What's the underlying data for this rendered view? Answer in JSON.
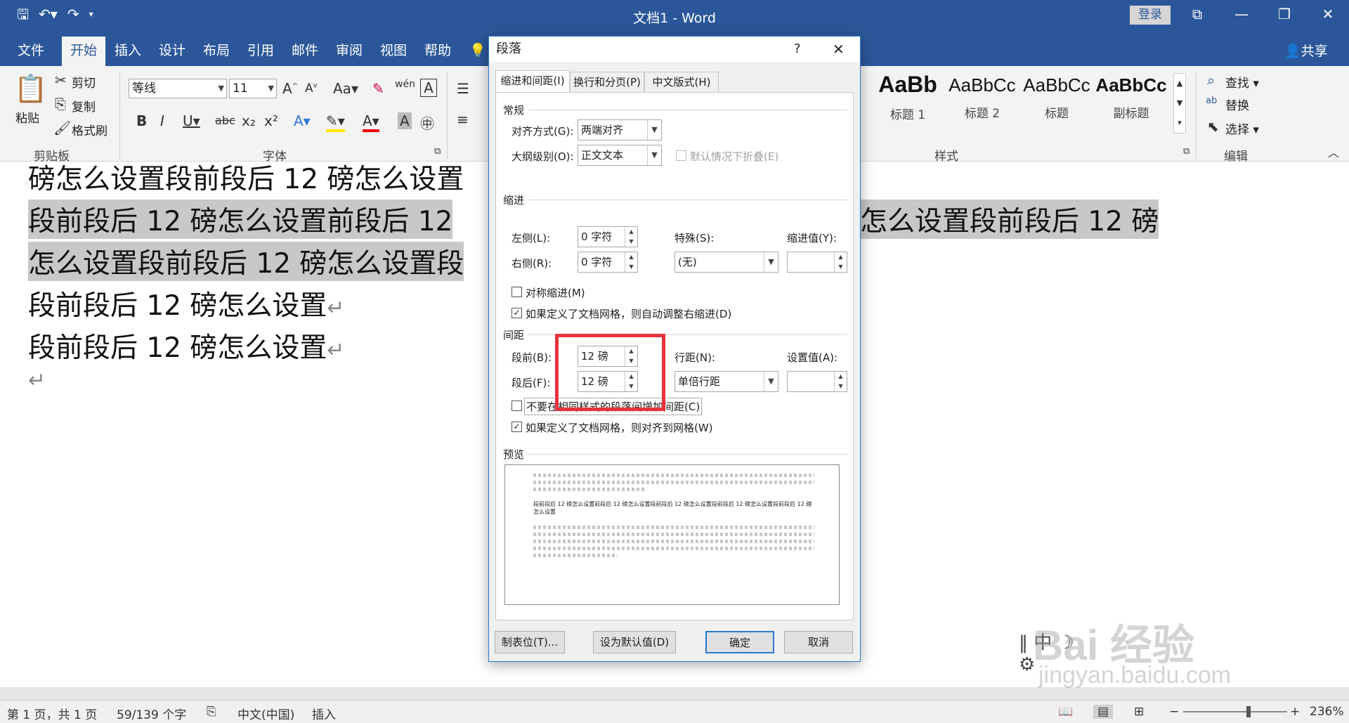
{
  "window": {
    "title": "文档1  -  Word",
    "login": "登录"
  },
  "tabs": [
    "文件",
    "开始",
    "插入",
    "设计",
    "布局",
    "引用",
    "邮件",
    "审阅",
    "视图",
    "帮助"
  ],
  "share": "共享",
  "ribbon": {
    "clipboard": {
      "paste": "粘贴",
      "cut": "剪切",
      "copy": "复制",
      "format_painter": "格式刷",
      "label": "剪贴板"
    },
    "font": {
      "name": "等线",
      "size": "11",
      "label": "字体"
    },
    "styles": {
      "items": [
        {
          "sample": "AaBb",
          "name": "标题 1"
        },
        {
          "sample": "AaBbCc",
          "name": "标题 2"
        },
        {
          "sample": "AaBbCc",
          "name": "标题"
        },
        {
          "sample": "AaBbCc",
          "name": "副标题"
        }
      ],
      "label": "样式"
    },
    "editing": {
      "find": "查找",
      "replace": "替换",
      "select": "选择",
      "label": "编辑"
    }
  },
  "document": {
    "line1": "磅怎么设置段前段后 12 磅怎么设置",
    "line2a": "段前段后 12 磅怎么设置前段后 12",
    "line2b": "怎么设置段前段后 12 磅",
    "line3": "怎么设置段前段后 12 磅怎么设置段",
    "line4": "段前段后 12 磅怎么设置",
    "line5": "段前段后 12 磅怎么设置",
    "mark": "↵"
  },
  "dialog": {
    "title": "段落",
    "help": "?",
    "close": "✕",
    "tabs": [
      "缩进和间距(I)",
      "换行和分页(P)",
      "中文版式(H)"
    ],
    "general": {
      "heading": "常规",
      "alignment_label": "对齐方式(G):",
      "alignment_value": "两端对齐",
      "outline_label": "大纲级别(O):",
      "outline_value": "正文文本",
      "collapse_label": "默认情况下折叠(E)"
    },
    "indent": {
      "heading": "缩进",
      "left_label": "左侧(L):",
      "left_value": "0 字符",
      "right_label": "右侧(R):",
      "right_value": "0 字符",
      "special_label": "特殊(S):",
      "special_value": "(无)",
      "by_label": "缩进值(Y):",
      "mirror_label": "对称缩进(M)",
      "auto_adjust_label": "如果定义了文档网格，则自动调整右缩进(D)"
    },
    "spacing": {
      "heading": "间距",
      "before_label": "段前(B):",
      "before_value": "12 磅",
      "after_label": "段后(F):",
      "after_value": "12 磅",
      "line_spacing_label": "行距(N):",
      "line_spacing_value": "单倍行距",
      "at_label": "设置值(A):",
      "no_space_label": "不要在相同样式的段落间增加间距(C)",
      "snap_grid_label": "如果定义了文档网格，则对齐到网格(W)"
    },
    "preview": {
      "heading": "预览",
      "sample": "段前段后 12 磅怎么设置前段后 12 磅怎么设置段前段后 12 磅怎么设置段前段后 12 磅怎么设置段前段后 12 磅怎么设置"
    },
    "buttons": {
      "tabs": "制表位(T)...",
      "default": "设为默认值(D)",
      "ok": "确定",
      "cancel": "取消"
    }
  },
  "status": {
    "page": "第 1 页，共 1 页",
    "words": "59/139 个字",
    "lang": "中文(中国)",
    "mode": "插入",
    "zoom": "236%"
  },
  "watermark": {
    "brand": "Bai 经验",
    "url": "jingyan.baidu.com"
  }
}
